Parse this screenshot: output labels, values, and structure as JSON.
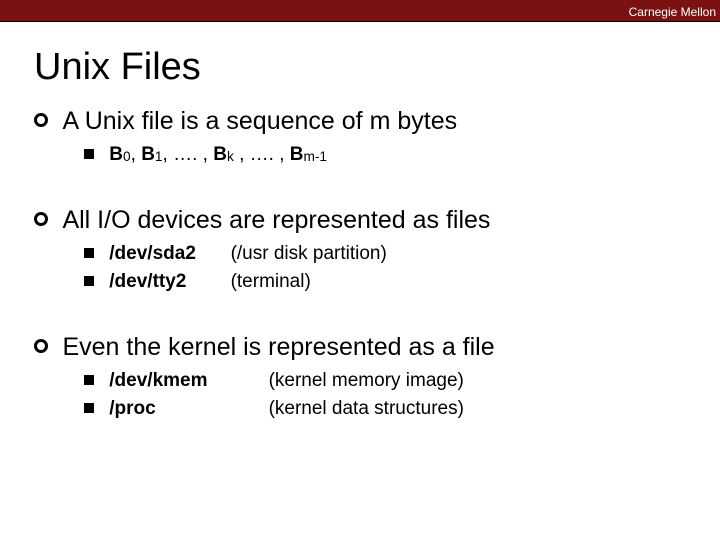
{
  "header": {
    "org": "Carnegie Mellon"
  },
  "title": "Unix Files",
  "points": [
    {
      "text": "A Unix file is a sequence of m bytes",
      "sub": [
        {
          "byteseq": {
            "b0": "B",
            "s0": "0",
            "sep1": ", ",
            "b1": "B",
            "s1": "1",
            "sep2": ", …. , ",
            "bk": "B",
            "sk": "k",
            "sep3": " , …. , ",
            "bm": "B",
            "sm": "m-1"
          }
        }
      ]
    },
    {
      "text": "All I/O devices are represented as files",
      "sub": [
        {
          "name": "/dev/sda2",
          "desc": "(/usr disk partition)"
        },
        {
          "name": "/dev/tty2",
          "desc": "(terminal)"
        }
      ]
    },
    {
      "text": "Even the kernel is represented as a file",
      "sub": [
        {
          "name": "/dev/kmem",
          "desc": "(kernel memory image)"
        },
        {
          "name": "/proc",
          "desc": "(kernel data structures)"
        }
      ]
    }
  ]
}
